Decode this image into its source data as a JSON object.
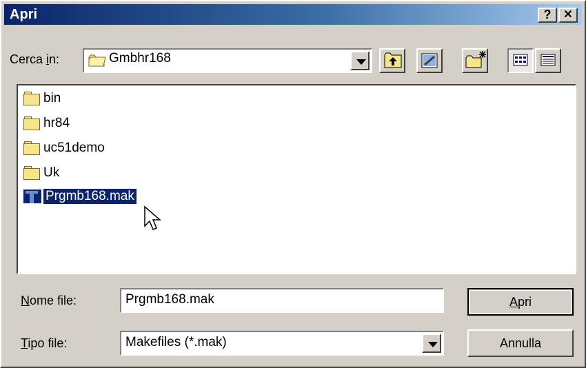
{
  "window": {
    "title": "Apri",
    "help_btn": "?",
    "close_btn": "✕"
  },
  "lookin": {
    "label_pre": "Cerca ",
    "label_u": "i",
    "label_post": "n:",
    "value": "Gmbhr168"
  },
  "files": [
    {
      "name": "bin",
      "type": "folder"
    },
    {
      "name": "hr84",
      "type": "folder"
    },
    {
      "name": "uc51demo",
      "type": "folder"
    },
    {
      "name": "Uk",
      "type": "folder"
    },
    {
      "name": "Prgmb168.mak",
      "type": "file",
      "selected": true
    }
  ],
  "filename": {
    "label_u": "N",
    "label_rest": "ome file:",
    "value": "Prgmb168.mak"
  },
  "filetype": {
    "label_u": "T",
    "label_rest": "ipo file:",
    "value": "Makefiles (*.mak)"
  },
  "buttons": {
    "open_u": "A",
    "open_rest": "pri",
    "cancel": "Annulla"
  },
  "icons": [
    "folder-icon",
    "up-folder-icon",
    "desktop-icon",
    "new-folder-icon",
    "list-view-icon",
    "details-view-icon",
    "makefile-icon",
    "mouse-cursor-icon"
  ]
}
